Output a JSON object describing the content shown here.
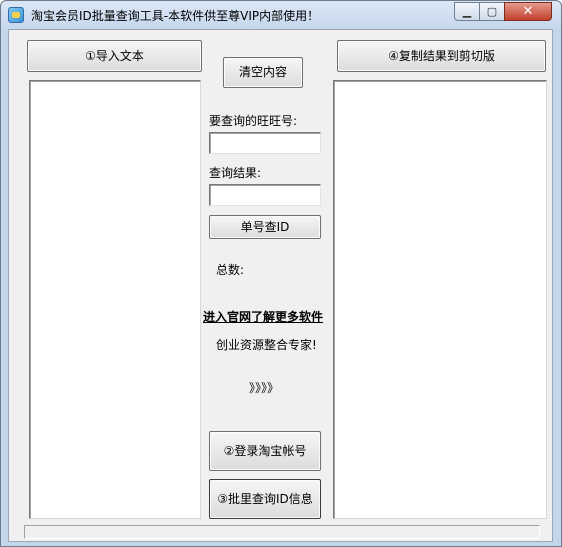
{
  "window": {
    "title": "淘宝会员ID批量查询工具-本软件供至尊VIP内部使用！",
    "min_glyph": "▁",
    "max_glyph": "▢",
    "close_glyph": "✕"
  },
  "toolbar": {
    "import_label": "①导入文本",
    "copy_label": "④复制结果到剪切版",
    "clear_label": "清空内容"
  },
  "query": {
    "wangwang_label": "要查询的旺旺号:",
    "wangwang_value": "",
    "result_label": "查询结果:",
    "result_value": "",
    "single_query_label": "单号查ID",
    "total_label": "总数:"
  },
  "promo": {
    "website_link": "进入官网了解更多软件",
    "slogan": "创业资源整合专家!",
    "arrows": "》》》》"
  },
  "actions": {
    "login_label": "②登录淘宝帐号",
    "batch_query_label": "③批里查询ID信息"
  }
}
